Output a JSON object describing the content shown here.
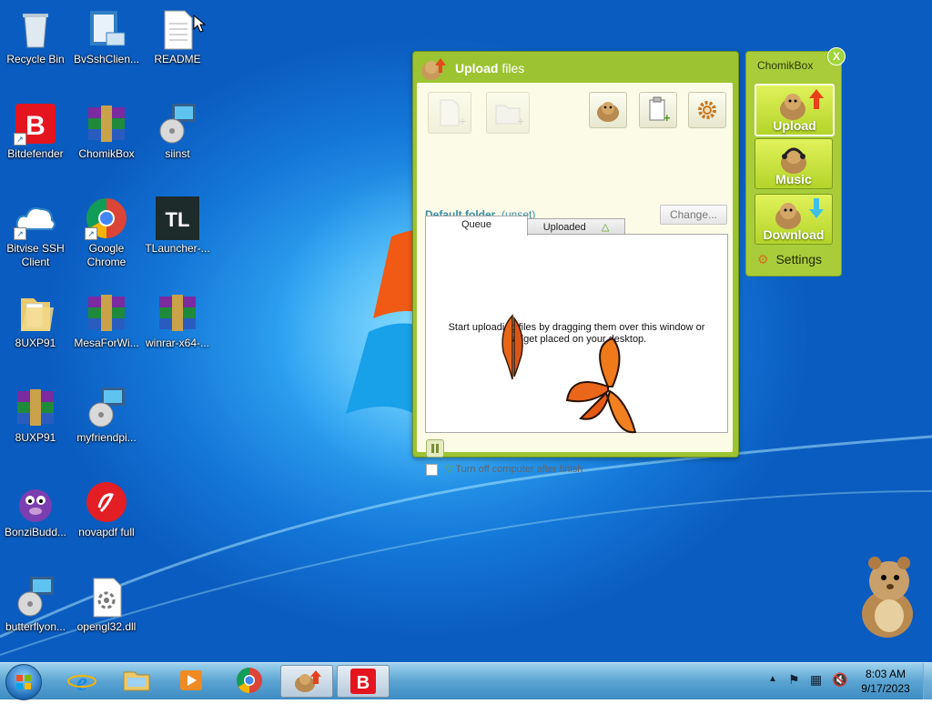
{
  "desktop_icons": [
    {
      "label": "Recycle Bin",
      "icon": "recycle-bin-icon"
    },
    {
      "label": "BvSshClien...",
      "icon": "bvssh-icon"
    },
    {
      "label": "README",
      "icon": "text-file-icon"
    },
    {
      "label": "Bitdefender",
      "icon": "bitdefender-icon"
    },
    {
      "label": "ChomikBox",
      "icon": "winrar-icon"
    },
    {
      "label": "siinst",
      "icon": "setup-icon"
    },
    {
      "label": "Bitvise SSH Client",
      "icon": "bitvise-cloud-icon"
    },
    {
      "label": "Google Chrome",
      "icon": "chrome-icon"
    },
    {
      "label": "TLauncher-...",
      "icon": "tlauncher-icon"
    },
    {
      "label": "8UXP91",
      "icon": "folder-icon"
    },
    {
      "label": "MesaForWi...",
      "icon": "winrar-icon"
    },
    {
      "label": "winrar-x64-...",
      "icon": "winrar-icon"
    },
    {
      "label": "8UXP91",
      "icon": "winrar-icon"
    },
    {
      "label": "myfriendpi...",
      "icon": "setup-icon"
    },
    {
      "label": "BonziBudd...",
      "icon": "bonzi-icon"
    },
    {
      "label": "novapdf full",
      "icon": "novapdf-icon"
    },
    {
      "label": "butterflyon...",
      "icon": "setup-icon"
    },
    {
      "label": "opengl32.dll",
      "icon": "dll-file-icon"
    }
  ],
  "upload_window": {
    "title_bold": "Upload",
    "title_rest": " files",
    "default_folder_label": "Default folder",
    "default_folder_value": "(unset)",
    "change_button": "Change...",
    "tabs": [
      "Queue",
      "Uploaded"
    ],
    "empty_message_line1": "Start uploading files by dragging them over this window or",
    "empty_message_line2": "gadget placed on your desktop.",
    "turn_off_label": "Turn off computer after finish"
  },
  "side_panel": {
    "title": "ChomikBox",
    "close": "X",
    "buttons": [
      "Upload",
      "Music",
      "Download"
    ],
    "settings": "Settings"
  },
  "taskbar": {
    "time": "8:03 AM",
    "date": "9/17/2023",
    "pinned": [
      "ie-icon",
      "explorer-icon",
      "media-player-icon",
      "chrome-icon",
      "chomikbox-icon",
      "bitdefender-icon"
    ]
  },
  "colors": {
    "chomik_green": "#9cc432",
    "desktop_blue": "#1477d8",
    "taskbar": "#5aa4d2"
  }
}
